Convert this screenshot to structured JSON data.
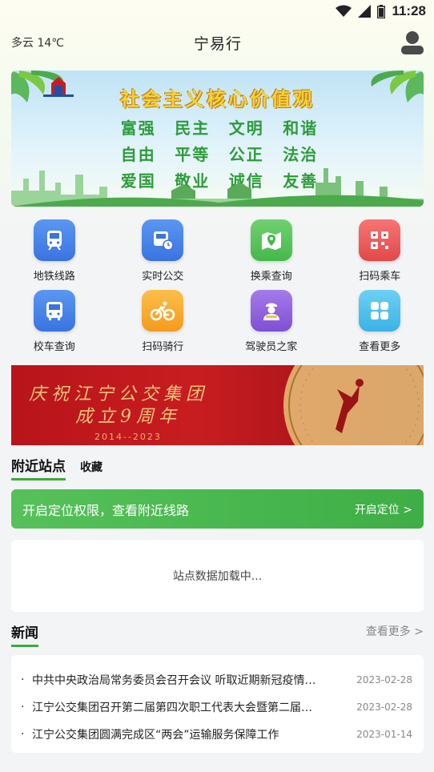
{
  "status_bar": {
    "time": "11:28"
  },
  "header": {
    "weather": "多云 14℃",
    "title": "宁易行"
  },
  "banner1": {
    "headline": "社会主义核心价值观",
    "values": [
      "富强",
      "民主",
      "文明",
      "和谐",
      "自由",
      "平等",
      "公正",
      "法治",
      "爱国",
      "敬业",
      "诚信",
      "友善"
    ]
  },
  "menu": [
    {
      "label": "地铁线路",
      "icon": "subway-icon",
      "color": "#3f7fe8"
    },
    {
      "label": "实时公交",
      "icon": "realtime-bus-icon",
      "color": "#3f7fe8"
    },
    {
      "label": "换乘查询",
      "icon": "map-pin-icon",
      "color": "#52c05a"
    },
    {
      "label": "扫码乘车",
      "icon": "qr-code-icon",
      "color": "#ef5a5a"
    },
    {
      "label": "校车查询",
      "icon": "school-bus-icon",
      "color": "#3f7fe8"
    },
    {
      "label": "扫码骑行",
      "icon": "bicycle-icon",
      "color": "#f5a623"
    },
    {
      "label": "驾驶员之家",
      "icon": "driver-icon",
      "color": "#8a5ad8"
    },
    {
      "label": "查看更多",
      "icon": "more-grid-icon",
      "color": "#3fb8e8"
    }
  ],
  "banner2": {
    "line1": "庆祝江宁公交集团",
    "line2": "成立9周年",
    "years": "2014--2023"
  },
  "tabs": {
    "nearby": "附近站点",
    "favorites": "收藏"
  },
  "location": {
    "text": "开启定位权限，查看附近线路",
    "button": "开启定位 >"
  },
  "loading": "站点数据加载中...",
  "news": {
    "title": "新闻",
    "more": "查看更多 >",
    "items": [
      {
        "text": "中共中央政治局常务委员会召开会议 听取近期新冠疫情…",
        "date": "2023-02-28"
      },
      {
        "text": "江宁公交集团召开第二届第四次职工代表大会暨第二届…",
        "date": "2023-02-28"
      },
      {
        "text": "江宁公交集团圆满完成区“两会”运输服务保障工作",
        "date": "2023-01-14"
      }
    ]
  },
  "colors": {
    "accent": "#3daa3f",
    "banner_red": "#c81d20"
  }
}
